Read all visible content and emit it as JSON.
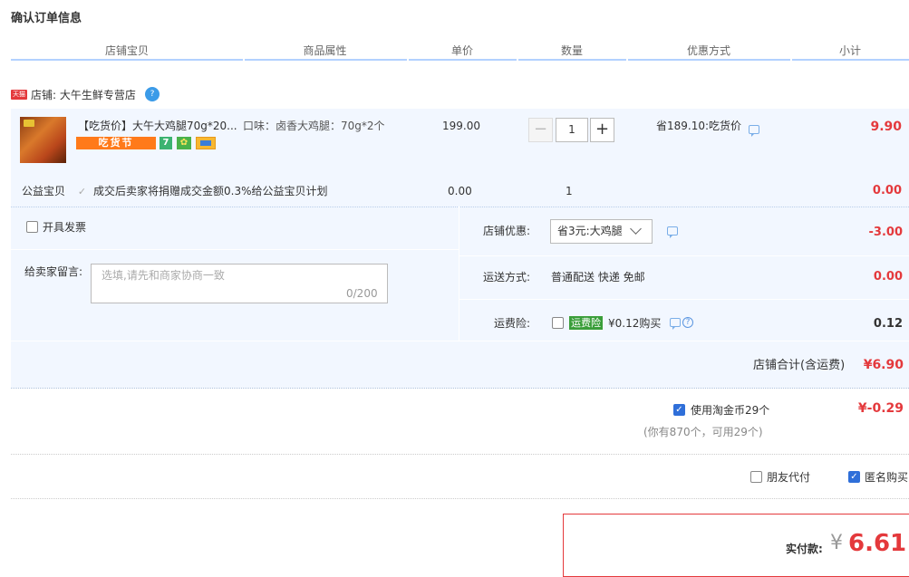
{
  "page_title": "确认订单信息",
  "columns": [
    "店铺宝贝",
    "商品属性",
    "单价",
    "数量",
    "优惠方式",
    "小计"
  ],
  "shop": {
    "badge": "天猫",
    "label": "店铺: 大午生鲜专营店"
  },
  "item": {
    "name": "【吃货价】大午大鸡腿70g*20...",
    "promo_badge": "吃货节",
    "service_icon_1": "7",
    "attr": "口味：卤香大鸡腿：70g*2个",
    "unit_price": "199.00",
    "quantity": "1",
    "minus": "−",
    "plus": "+",
    "discount": "省189.10:吃货价",
    "subtotal": "9.90"
  },
  "charity": {
    "label": "公益宝贝",
    "desc": "成交后卖家将捐赠成交金额0.3%给公益宝贝计划",
    "price": "0.00",
    "qty": "1",
    "subtotal": "0.00"
  },
  "invoice_label": "开具发票",
  "message": {
    "label": "给卖家留言:",
    "placeholder": "选填,请先和商家协商一致",
    "count": "0/200"
  },
  "shop_discount": {
    "label": "店铺优惠:",
    "selected": "省3元:大鸡腿",
    "value": "-3.00"
  },
  "shipping": {
    "label": "运送方式:",
    "desc": "普通配送 快递 免邮",
    "value": "0.00"
  },
  "insurance": {
    "label": "运费险:",
    "tag": "运费险",
    "desc": "¥0.12购买",
    "value": "0.12"
  },
  "shop_total": {
    "label": "店铺合计(含运费)",
    "value": "¥6.90"
  },
  "coins": {
    "label": "使用淘金币29个",
    "value": "¥-0.29",
    "hint": "(你有870个，可用29个)"
  },
  "friend_pay_label": "朋友代付",
  "anonymous_label": "匿名购买",
  "pay": {
    "label": "实付款:",
    "currency": "¥",
    "value": "6.61"
  },
  "colors": {
    "price_red": "#e4393c",
    "header_line": "#b2d1ff",
    "section_bg": "#f2f7ff",
    "checkbox_blue": "#2f6fd9"
  }
}
